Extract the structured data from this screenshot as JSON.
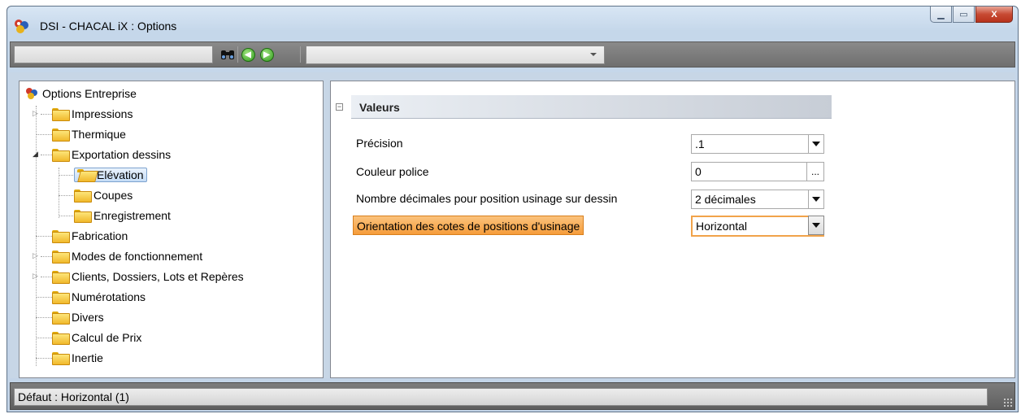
{
  "window": {
    "title": "DSI - CHACAL iX : Options",
    "minimize_glyph": "▁",
    "maximize_glyph": "▭",
    "close_glyph": "X"
  },
  "toolbar": {
    "search_value": "",
    "combo_value": "",
    "icons": [
      "binoculars-icon",
      "back-arrow-icon",
      "forward-arrow-icon"
    ]
  },
  "tree": {
    "root": "Options Entreprise",
    "items": [
      {
        "label": "Impressions",
        "level": 1,
        "expander": "▷"
      },
      {
        "label": "Thermique",
        "level": 1,
        "expander": ""
      },
      {
        "label": "Exportation dessins",
        "level": 1,
        "expander": "◢"
      },
      {
        "label": "Elévation",
        "level": 2,
        "expander": "",
        "selected": true
      },
      {
        "label": "Coupes",
        "level": 2,
        "expander": ""
      },
      {
        "label": "Enregistrement",
        "level": 2,
        "expander": ""
      },
      {
        "label": "Fabrication",
        "level": 1,
        "expander": ""
      },
      {
        "label": "Modes de fonctionnement",
        "level": 1,
        "expander": "▷"
      },
      {
        "label": "Clients, Dossiers, Lots et Repères",
        "level": 1,
        "expander": "▷"
      },
      {
        "label": "Numérotations",
        "level": 1,
        "expander": ""
      },
      {
        "label": "Divers",
        "level": 1,
        "expander": ""
      },
      {
        "label": "Calcul de Prix",
        "level": 1,
        "expander": ""
      },
      {
        "label": "Inertie",
        "level": 1,
        "expander": ""
      }
    ]
  },
  "properties": {
    "group_title": "Valeurs",
    "collapse_glyph": "−",
    "rows": [
      {
        "label": "Précision",
        "value": ".1",
        "editor": "dropdown"
      },
      {
        "label": "Couleur police",
        "value": "0",
        "editor": "ellipsis"
      },
      {
        "label": "Nombre décimales pour position usinage sur dessin",
        "value": "2 décimales",
        "editor": "dropdown"
      },
      {
        "label": "Orientation des cotes de positions d'usinage",
        "value": "Horizontal",
        "editor": "dropdown",
        "active": true
      }
    ],
    "ellipsis_glyph": "..."
  },
  "status": {
    "text": "Défaut : Horizontal (1)"
  },
  "colors": {
    "selection_orange": "#f59c3a",
    "folder_yellow": "#f1b82b",
    "close_red": "#c74a33"
  }
}
